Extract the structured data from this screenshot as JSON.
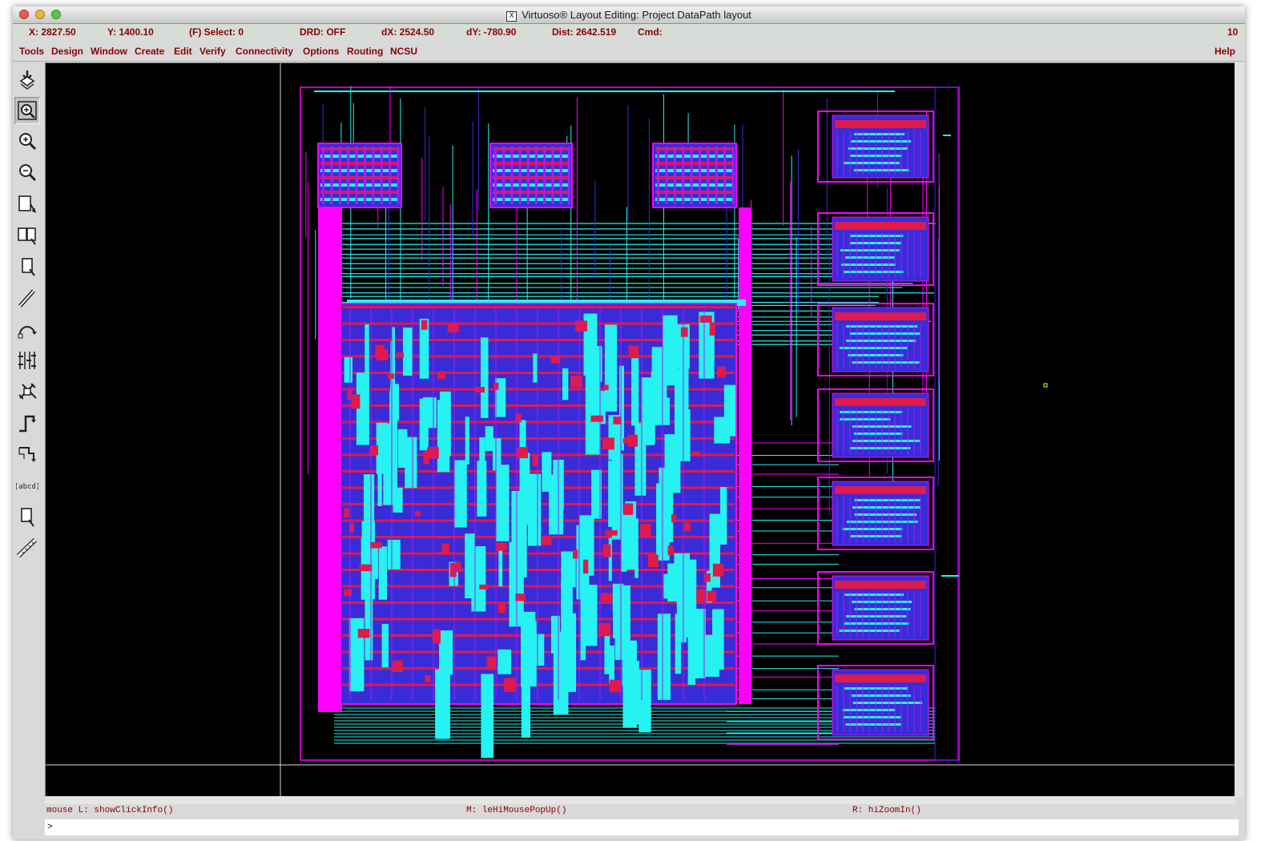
{
  "window": {
    "title": "Virtuoso® Layout Editing: Project DataPath layout",
    "controls": [
      "close-button",
      "minimize-button",
      "zoom-button"
    ]
  },
  "status": {
    "x": "X:  2827.50",
    "y": "Y:  1400.10",
    "select": "(F) Select: 0",
    "drd": "DRD: OFF",
    "dx": "dX:  2524.50",
    "dy": "dY: -780.90",
    "dist": "Dist: 2642.519",
    "cmd": "Cmd:",
    "count": "10"
  },
  "menu": {
    "items": [
      "Tools",
      "Design",
      "Window",
      "Create",
      "Edit",
      "Verify",
      "Connectivity",
      "Options",
      "Routing",
      "NCSU"
    ],
    "help": "Help"
  },
  "toolbar": {
    "tools": [
      "save-icon",
      "fit-view-icon",
      "zoom-in-icon",
      "zoom-out-icon",
      "stretch-icon",
      "copy-icon",
      "move-icon",
      "path-icon",
      "undo-icon",
      "instance-icon",
      "properties-icon",
      "wire-icon",
      "polygon-icon",
      "label-icon",
      "rectangle-icon",
      "ruler-icon"
    ]
  },
  "layout": {
    "colors": {
      "background": "#000000",
      "metal1": "#3a2bd8",
      "metal2": "#26f2f2",
      "poly": "#e01a4a",
      "boundary": "#ff00ff",
      "via": "#a020f0",
      "cursor_marker": "#ffff00"
    }
  },
  "mouse": {
    "left": "mouse L: showClickInfo()",
    "middle": "M: leHiMousePopUp()",
    "right": "R: hiZoomIn()"
  },
  "command": {
    "prompt": ">"
  }
}
